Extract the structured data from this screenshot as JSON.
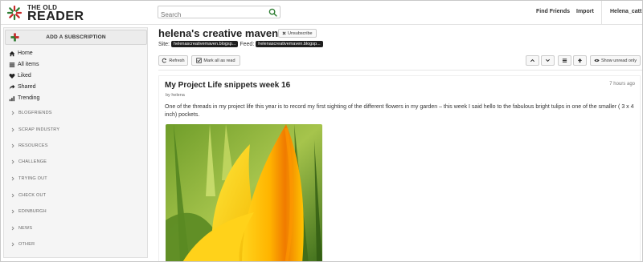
{
  "app": {
    "logo_small": "THE OLD",
    "logo_big": "READER"
  },
  "topbar": {
    "search_placeholder": "Search",
    "find_friends": "Find Friends",
    "import": "Import",
    "user": "Helena_catt"
  },
  "sidebar": {
    "add_subscription": "ADD A SUBSCRIPTION",
    "nav": [
      {
        "label": "Home"
      },
      {
        "label": "All items"
      },
      {
        "label": "Liked"
      },
      {
        "label": "Shared"
      },
      {
        "label": "Trending"
      }
    ],
    "folders": [
      {
        "label": "BLOGFRIENDS"
      },
      {
        "label": "SCRAP INDUSTRY"
      },
      {
        "label": "RESOURCES"
      },
      {
        "label": "CHALLENGE"
      },
      {
        "label": "TRYING OUT"
      },
      {
        "label": "CHECK OUT"
      },
      {
        "label": "EDINBURGH"
      },
      {
        "label": "NEWS"
      },
      {
        "label": "OTHER"
      }
    ]
  },
  "feed": {
    "title": "helena's creative maven",
    "unsubscribe": "Unsubscribe",
    "site_label": "Site:",
    "site_value": "helenascreativemaven.blogsp...",
    "feed_label": "Feed:",
    "feed_value": "helenascreativemaven.blogsp..."
  },
  "toolbar": {
    "refresh": "Refresh",
    "mark_all_read": "Mark all as read",
    "show_unread": "Show unread only"
  },
  "article": {
    "title": "My Project Life snippets week 16",
    "time": "7 hours ago",
    "author": "by helena",
    "body": "One of the threads in my project life this year is to record my first sighting of the different flowers in my garden – this week I said hello to the fabulous bright tulips in one of the smaller ( 3 x 4 inch) pockets."
  },
  "colors": {
    "logo_green": "#2e7d32",
    "logo_red": "#c62828",
    "pill_bg": "#1e1e1e",
    "sidebar_bg": "#f5f5f5"
  }
}
